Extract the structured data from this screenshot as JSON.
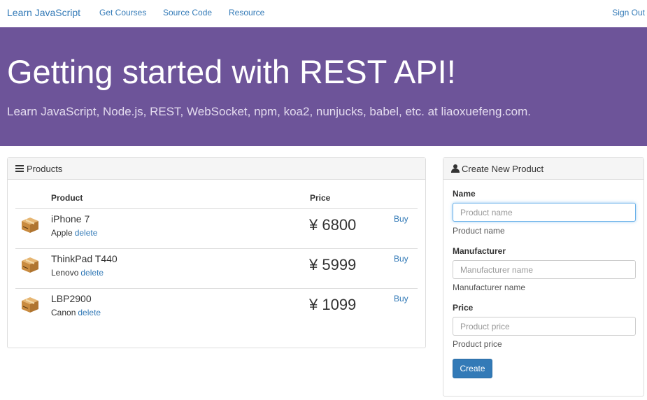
{
  "navbar": {
    "brand": "Learn JavaScript",
    "links": [
      "Get Courses",
      "Source Code",
      "Resource"
    ],
    "sign_out": "Sign Out"
  },
  "hero": {
    "title": "Getting started with REST API!",
    "subtitle": "Learn JavaScript, Node.js, REST, WebSocket, npm, koa2, nunjucks, babel, etc. at liaoxuefeng.com."
  },
  "products_panel": {
    "heading": "Products",
    "icon": "list-icon",
    "columns": [
      "Product",
      "Price"
    ],
    "rows": [
      {
        "name": "iPhone 7",
        "manufacturer": "Apple",
        "delete": "delete",
        "price": "¥ 6800",
        "buy": "Buy",
        "icon": "package-box-icon"
      },
      {
        "name": "ThinkPad T440",
        "manufacturer": "Lenovo",
        "delete": "delete",
        "price": "¥ 5999",
        "buy": "Buy",
        "icon": "package-box-icon"
      },
      {
        "name": "LBP2900",
        "manufacturer": "Canon",
        "delete": "delete",
        "price": "¥ 1099",
        "buy": "Buy",
        "icon": "package-box-icon"
      }
    ]
  },
  "create_panel": {
    "heading": "Create New Product",
    "icon": "user-icon",
    "fields": [
      {
        "label": "Name",
        "placeholder": "Product name",
        "help": "Product name"
      },
      {
        "label": "Manufacturer",
        "placeholder": "Manufacturer name",
        "help": "Manufacturer name"
      },
      {
        "label": "Price",
        "placeholder": "Product price",
        "help": "Product price"
      }
    ],
    "submit": "Create"
  },
  "colors": {
    "hero_bg": "#6d5499",
    "link": "#337ab7",
    "primary_button": "#337ab7"
  }
}
